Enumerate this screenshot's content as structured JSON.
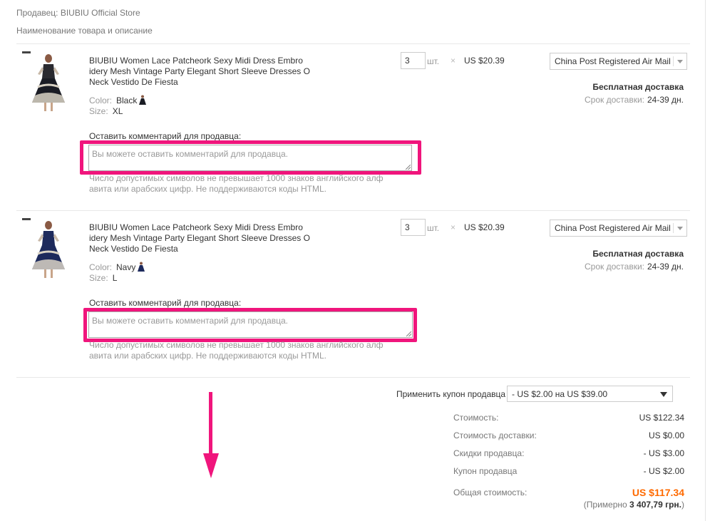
{
  "seller_line": "Продавец: BIUBIU Official Store",
  "columns_header": "Наименование товара и описание",
  "items": [
    {
      "title": "BIUBIU Women Lace Patcheork Sexy Midi Dress Embro idery Mesh Vintage Party Elegant Short Sleeve Dresses O Neck Vestido De Fiesta",
      "color_label": "Color:",
      "color_value": "Black",
      "size_label": "Size:",
      "size_value": "XL",
      "quantity": "3",
      "unit": "шт.",
      "times": "×",
      "price": "US $20.39",
      "shipping_method": "China Post Registered Air Mail",
      "free_shipping": "Бесплатная доставка",
      "delivery_label": "Срок доставки:",
      "delivery_value": "24-39 дн.",
      "comment_label": "Оставить комментарий для продавца:",
      "comment_placeholder": "Вы можете оставить комментарий для продавца.",
      "hint": "Число допустимых символов не превышает 1000 знаков английского алф авита или арабских цифр. Не поддерживаются коды HTML.",
      "skirt_color": "#1a1c24"
    },
    {
      "title": "BIUBIU Women Lace Patcheork Sexy Midi Dress Embro idery Mesh Vintage Party Elegant Short Sleeve Dresses O Neck Vestido De Fiesta",
      "color_label": "Color:",
      "color_value": "Navy",
      "size_label": "Size:",
      "size_value": "L",
      "quantity": "3",
      "unit": "шт.",
      "times": "×",
      "price": "US $20.39",
      "shipping_method": "China Post Registered Air Mail",
      "free_shipping": "Бесплатная доставка",
      "delivery_label": "Срок доставки:",
      "delivery_value": "24-39 дн.",
      "comment_label": "Оставить комментарий для продавца:",
      "comment_placeholder": "Вы можете оставить комментарий для продавца.",
      "hint": "Число допустимых символов не превышает 1000 знаков английского алф авита или арабских цифр. Не поддерживаются коды HTML.",
      "skirt_color": "#1d2a5c"
    }
  ],
  "coupon": {
    "label": "Применить купон продавца",
    "selected": "- US $2.00 на US $39.00"
  },
  "summary": {
    "cost_label": "Стоимость:",
    "cost_value": "US $122.34",
    "shipping_label": "Стоимость доставки:",
    "shipping_value": "US $0.00",
    "discount_label": "Скидки продавца:",
    "discount_value": "- US $3.00",
    "coupon_label": "Купон продавца",
    "coupon_value": "- US $2.00",
    "total_label": "Общая стоимость:",
    "total_value": "US $117.34",
    "approx_prefix": "(Примерно",
    "approx_value": "3 407,79 грн.",
    "approx_suffix": ")"
  },
  "colors": {
    "highlight": "#f0157c",
    "total": "#ff6a00"
  }
}
